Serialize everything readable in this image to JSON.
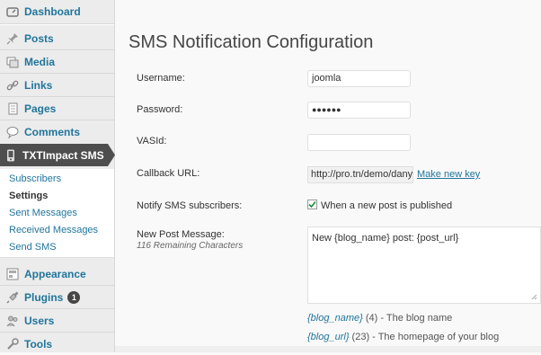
{
  "sidebar": {
    "dashboard": "Dashboard",
    "posts": "Posts",
    "media": "Media",
    "links": "Links",
    "pages": "Pages",
    "comments": "Comments",
    "txtimpact": "TXTImpact SMS",
    "submenu": [
      "Subscribers",
      "Settings",
      "Sent Messages",
      "Received Messages",
      "Send SMS"
    ],
    "appearance": "Appearance",
    "plugins": "Plugins",
    "plugins_badge": "1",
    "users": "Users",
    "tools": "Tools"
  },
  "page": {
    "title": "SMS Notification Configuration",
    "fields": {
      "username_label": "Username:",
      "username_value": "joomla",
      "password_label": "Password:",
      "password_value": "●●●●●●",
      "vasid_label": "VASId:",
      "vasid_value": "",
      "callback_label": "Callback URL:",
      "callback_prefix": "http://pro.tn/demo/dany/",
      "make_new_key": "Make new key",
      "notify_label": "Notify SMS subscribers:",
      "notify_option": "When a new post is published",
      "notify_checked": true,
      "newpost_label": "New Post Message:",
      "remaining": "116 Remaining Characters",
      "newpost_value": "New {blog_name} post: {post_url}"
    },
    "hints": [
      {
        "tag": "{blog_name}",
        "text": " (4) - The blog name"
      },
      {
        "tag": "{blog_url}",
        "text": " (23) - The homepage of your blog"
      }
    ]
  },
  "colors": {
    "accent": "#21759b",
    "active_menu": "#464646"
  }
}
